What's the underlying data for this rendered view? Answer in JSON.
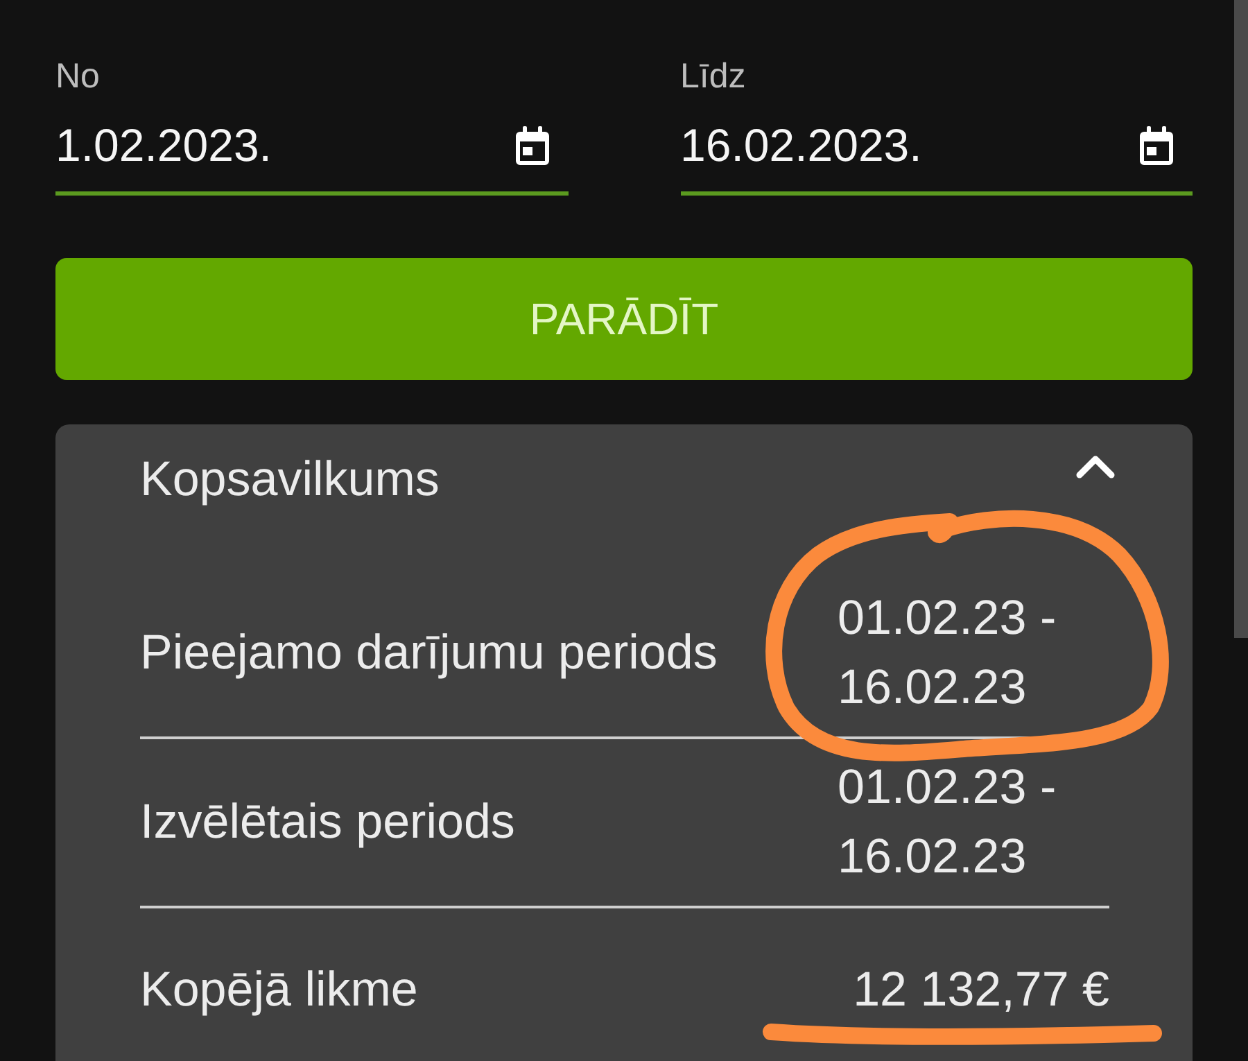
{
  "date_filter": {
    "fields": [
      {
        "label": "No",
        "value": "1.02.2023."
      },
      {
        "label": "Līdz",
        "value": "16.02.2023."
      }
    ],
    "button": "PARĀDĪT"
  },
  "summary": {
    "title": "Kopsavilkums",
    "expanded": true,
    "rows": [
      {
        "label": "Pieejamo darījumu periods",
        "value": "01.02.23 - 16.02.23"
      },
      {
        "label": "Izvēlētais periods",
        "value": "01.02.23 - 16.02.23"
      },
      {
        "label": "Kopējā likme",
        "value": "12 132,77 €"
      }
    ]
  }
}
